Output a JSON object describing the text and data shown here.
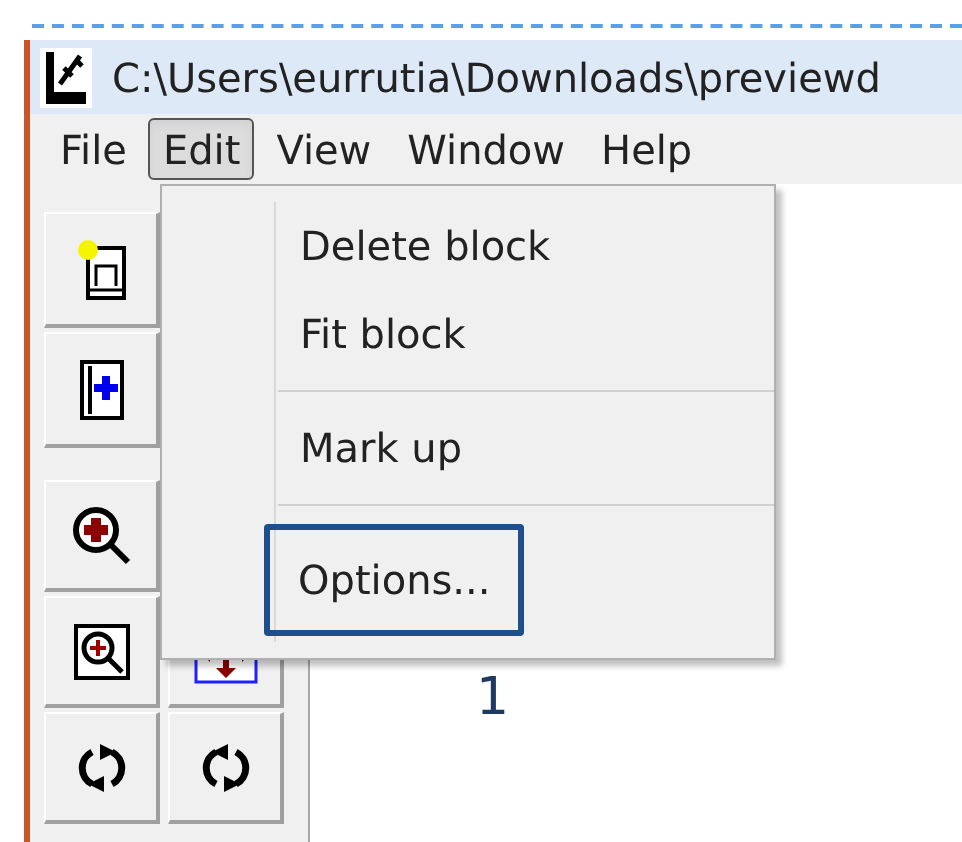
{
  "window": {
    "title": "C:\\Users\\eurrutia\\Downloads\\previewd"
  },
  "menu_bar": [
    {
      "label": "File",
      "selected": false
    },
    {
      "label": "Edit",
      "selected": true
    },
    {
      "label": "View",
      "selected": false
    },
    {
      "label": "Window",
      "selected": false
    },
    {
      "label": "Help",
      "selected": false
    }
  ],
  "dropdown": [
    {
      "kind": "item",
      "label": "Delete block",
      "highlighted": false
    },
    {
      "kind": "item",
      "label": "Fit block",
      "highlighted": false
    },
    {
      "kind": "separator"
    },
    {
      "kind": "item",
      "label": "Mark up",
      "highlighted": false
    },
    {
      "kind": "separator"
    },
    {
      "kind": "item",
      "label": "Options...",
      "highlighted": true
    }
  ],
  "callout": {
    "label": "1"
  }
}
